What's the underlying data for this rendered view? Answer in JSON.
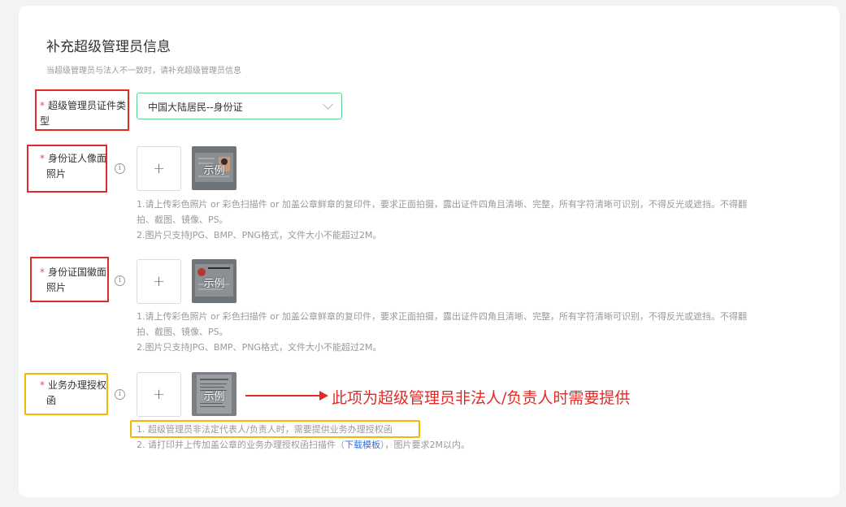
{
  "page": {
    "title": "补充超级管理员信息",
    "subtitle": "当超级管理员与法人不一致时，请补充超级管理员信息"
  },
  "fields": {
    "cert_type": {
      "required_mark": "*",
      "label": "超级管理员证件类型",
      "value": "中国大陆居民--身份证"
    },
    "id_front": {
      "required_mark": "*",
      "label_line1": "身份证人像面",
      "label_line2": "照片",
      "info_glyph": "i",
      "plus": "+",
      "sample_label": "示例",
      "hint_line1": "1.请上传彩色照片 or 彩色扫描件 or 加盖公章鲜章的复印件，要求正面拍摄，露出证件四角且清晰、完整，所有字符清晰可识别，不得反光或遮挡。不得翻",
      "hint_line2": "拍、截图、镜像、PS。",
      "hint_line3": "2.图片只支持JPG、BMP、PNG格式，文件大小不能超过2M。"
    },
    "id_back": {
      "required_mark": "*",
      "label_line1": "身份证国徽面",
      "label_line2": "照片",
      "info_glyph": "i",
      "plus": "+",
      "sample_label": "示例",
      "hint_line1": "1.请上传彩色照片 or 彩色扫描件 or 加盖公章鲜章的复印件，要求正面拍摄，露出证件四角且清晰、完整，所有字符清晰可识别，不得反光或遮挡。不得翻",
      "hint_line2": "拍、截图、镜像、PS。",
      "hint_line3": "2.图片只支持JPG、BMP、PNG格式，文件大小不能超过2M。"
    },
    "authorization": {
      "required_mark": "*",
      "label_line1": "业务办理授权",
      "label_line2": "函",
      "info_glyph": "i",
      "plus": "+",
      "sample_label": "示例",
      "hint_line1": "1. 超级管理员非法定代表人/负责人时，需要提供业务办理授权函",
      "hint_line2_pre": "2. 请打印并上传加盖公章的业务办理授权函扫描件（",
      "hint_line2_link": "下载模板",
      "hint_line2_post": "），图片要求2M以内。"
    }
  },
  "annotation": {
    "text": "此项为超级管理员非法人/负责人时需要提供"
  },
  "colors": {
    "accent_red": "#e02b27",
    "highlight_yellow": "#f5b800",
    "select_border": "#5fcf93",
    "link": "#3b6fd1"
  }
}
